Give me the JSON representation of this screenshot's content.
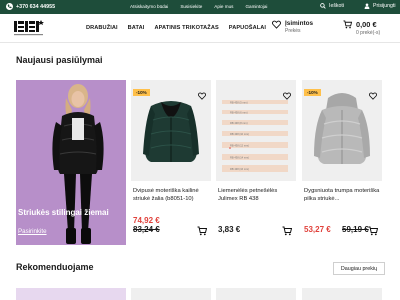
{
  "topbar": {
    "phone": "+370 634 44955",
    "links": [
      "Atsiskaitymo būdai",
      "Susisiekite",
      "Apie mus",
      "Gamintojai"
    ],
    "search_label": "Ieškoti",
    "login_label": "Prisijungti"
  },
  "brand": {
    "logo_text": "BBT",
    "tagline": "MY FAVORITE BRAND"
  },
  "nav": [
    "DRABUŽIAI",
    "BATAI",
    "APATINIS TRIKOTAŽAS",
    "PAPUOŠALAI"
  ],
  "wishlist": {
    "label": "Įsimintos",
    "sub": "Prekės"
  },
  "cart": {
    "total": "0,00 €",
    "sub": "0 prekė(-s)"
  },
  "section_new": {
    "title": "Naujausi pasiūlymai"
  },
  "promo": {
    "title": "Striukės stilingai žiemai",
    "link": "Pasirinkite"
  },
  "products": [
    {
      "badge": "-10%",
      "name": "Dvipusė moteriška kailinė striukė žalia (b8051-10)",
      "price_new": "74,92 €",
      "price_old": "83,24 €"
    },
    {
      "badge": "",
      "name": "Liemenėlės petnešėlės Julimex RB 438",
      "price": "3,83 €",
      "size_labels": [
        "RB 438 (5 mm)",
        "RB 438 (6 mm)",
        "RB 438 (8 mm)",
        "RB 438 (10 mm)",
        "RB 438 (12 mm)",
        "RB 438 (14 mm)",
        "RB 438 (16 mm)"
      ]
    },
    {
      "badge": "-10%",
      "name": "Dygsniuota trumpa moteriška pilka striukė...",
      "price_new": "53,27 €",
      "price_old": "59,19 €"
    }
  ],
  "section_rec": {
    "title": "Rekomenduojame",
    "more": "Daugiau prekių"
  },
  "colors": {
    "topbar": "#1e4d3a",
    "promo_bg": "#b78fc9",
    "sale": "#e0413b",
    "badge": "#ffc04a"
  }
}
